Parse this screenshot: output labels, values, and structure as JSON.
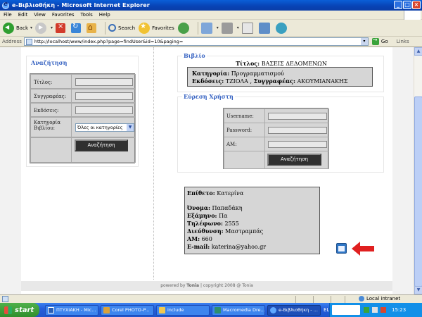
{
  "window": {
    "title": "e-Βιβλιοθήκη - Microsoft Internet Explorer",
    "buttons": [
      "_",
      "□",
      "×"
    ]
  },
  "menu": [
    "File",
    "Edit",
    "View",
    "Favorites",
    "Tools",
    "Help"
  ],
  "toolbar": {
    "back": "Back",
    "search": "Search",
    "favorites": "Favorites"
  },
  "address": {
    "label": "Address",
    "url": "http://localhost/www/index.php?page=findUser&id=10&paging=",
    "go": "Go",
    "links": "Links"
  },
  "left_search": {
    "title": "Αναζήτηση",
    "fields": [
      {
        "label": "Τίτλος:"
      },
      {
        "label": "Συγγραφέας:"
      },
      {
        "label": "Εκδόσεις:"
      }
    ],
    "category_label": "Κατηγορία Βιβλίου:",
    "category_value": "Όλες οι κατηγορίες",
    "button": "Αναζήτηση"
  },
  "book": {
    "section_title": "Βιβλίο",
    "title_label": "Τίτλος:",
    "title_value": "ΒΑΣΕΙΣ ΔΕΔΟΜΕΝΩΝ",
    "category_label": "Κατηγορία:",
    "category_value": "Προγραμματισμού",
    "publisher_label": "Εκδόσεις:",
    "publisher_value": "ΤΖΙΟΛΑ",
    "author_label": "Συγγραφέας:",
    "author_value": "ΑΚΟΥΜΙΑΝΑΚΗΣ"
  },
  "user_search": {
    "section_title": "Εύρεση Χρήστη",
    "fields": [
      {
        "label": "Username:"
      },
      {
        "label": "Password:"
      },
      {
        "label": "AM:"
      }
    ],
    "button": "Αναζήτηση"
  },
  "result": {
    "surname_label": "Επίθετο:",
    "surname": "Κατερίνα",
    "name_label": "Όνομα:",
    "name": "Παπαδάκη",
    "semester_label": "Εξάμηνο:",
    "semester": "Πα",
    "phone_label": "Τηλέφωνο:",
    "phone": "2555",
    "address_label": "Διεύθυνση:",
    "address": "Μαστραμπάς",
    "am_label": "AM:",
    "am": "660",
    "email_label": "E-mail:",
    "email": "katerina@yahoo.gr"
  },
  "footer": {
    "powered_prefix": "powered by ",
    "powered_name": "Tonia",
    "copyright": " | copyright 2008 @ Tonia"
  },
  "status": {
    "zone": "Local intranet"
  },
  "taskbar": {
    "start": "start",
    "tasks": [
      {
        "label": "ΠΤΥΧΙΑΚΗ - Mic...",
        "color": "#2b5fb5"
      },
      {
        "label": "Corel PHOTO-P...",
        "color": "#d9a23b"
      },
      {
        "label": "include",
        "color": "#f0c850"
      },
      {
        "label": "Macromedia Dre...",
        "color": "#2f8f6f"
      },
      {
        "label": "e-Βιβλιοθήκη - ...",
        "color": "#5fa8ff"
      }
    ],
    "lang": "EL",
    "clock": "15:23"
  },
  "colors": {
    "section_title": "#3763c2",
    "panel": "#d6d6d6",
    "arrow": "#e02020"
  }
}
